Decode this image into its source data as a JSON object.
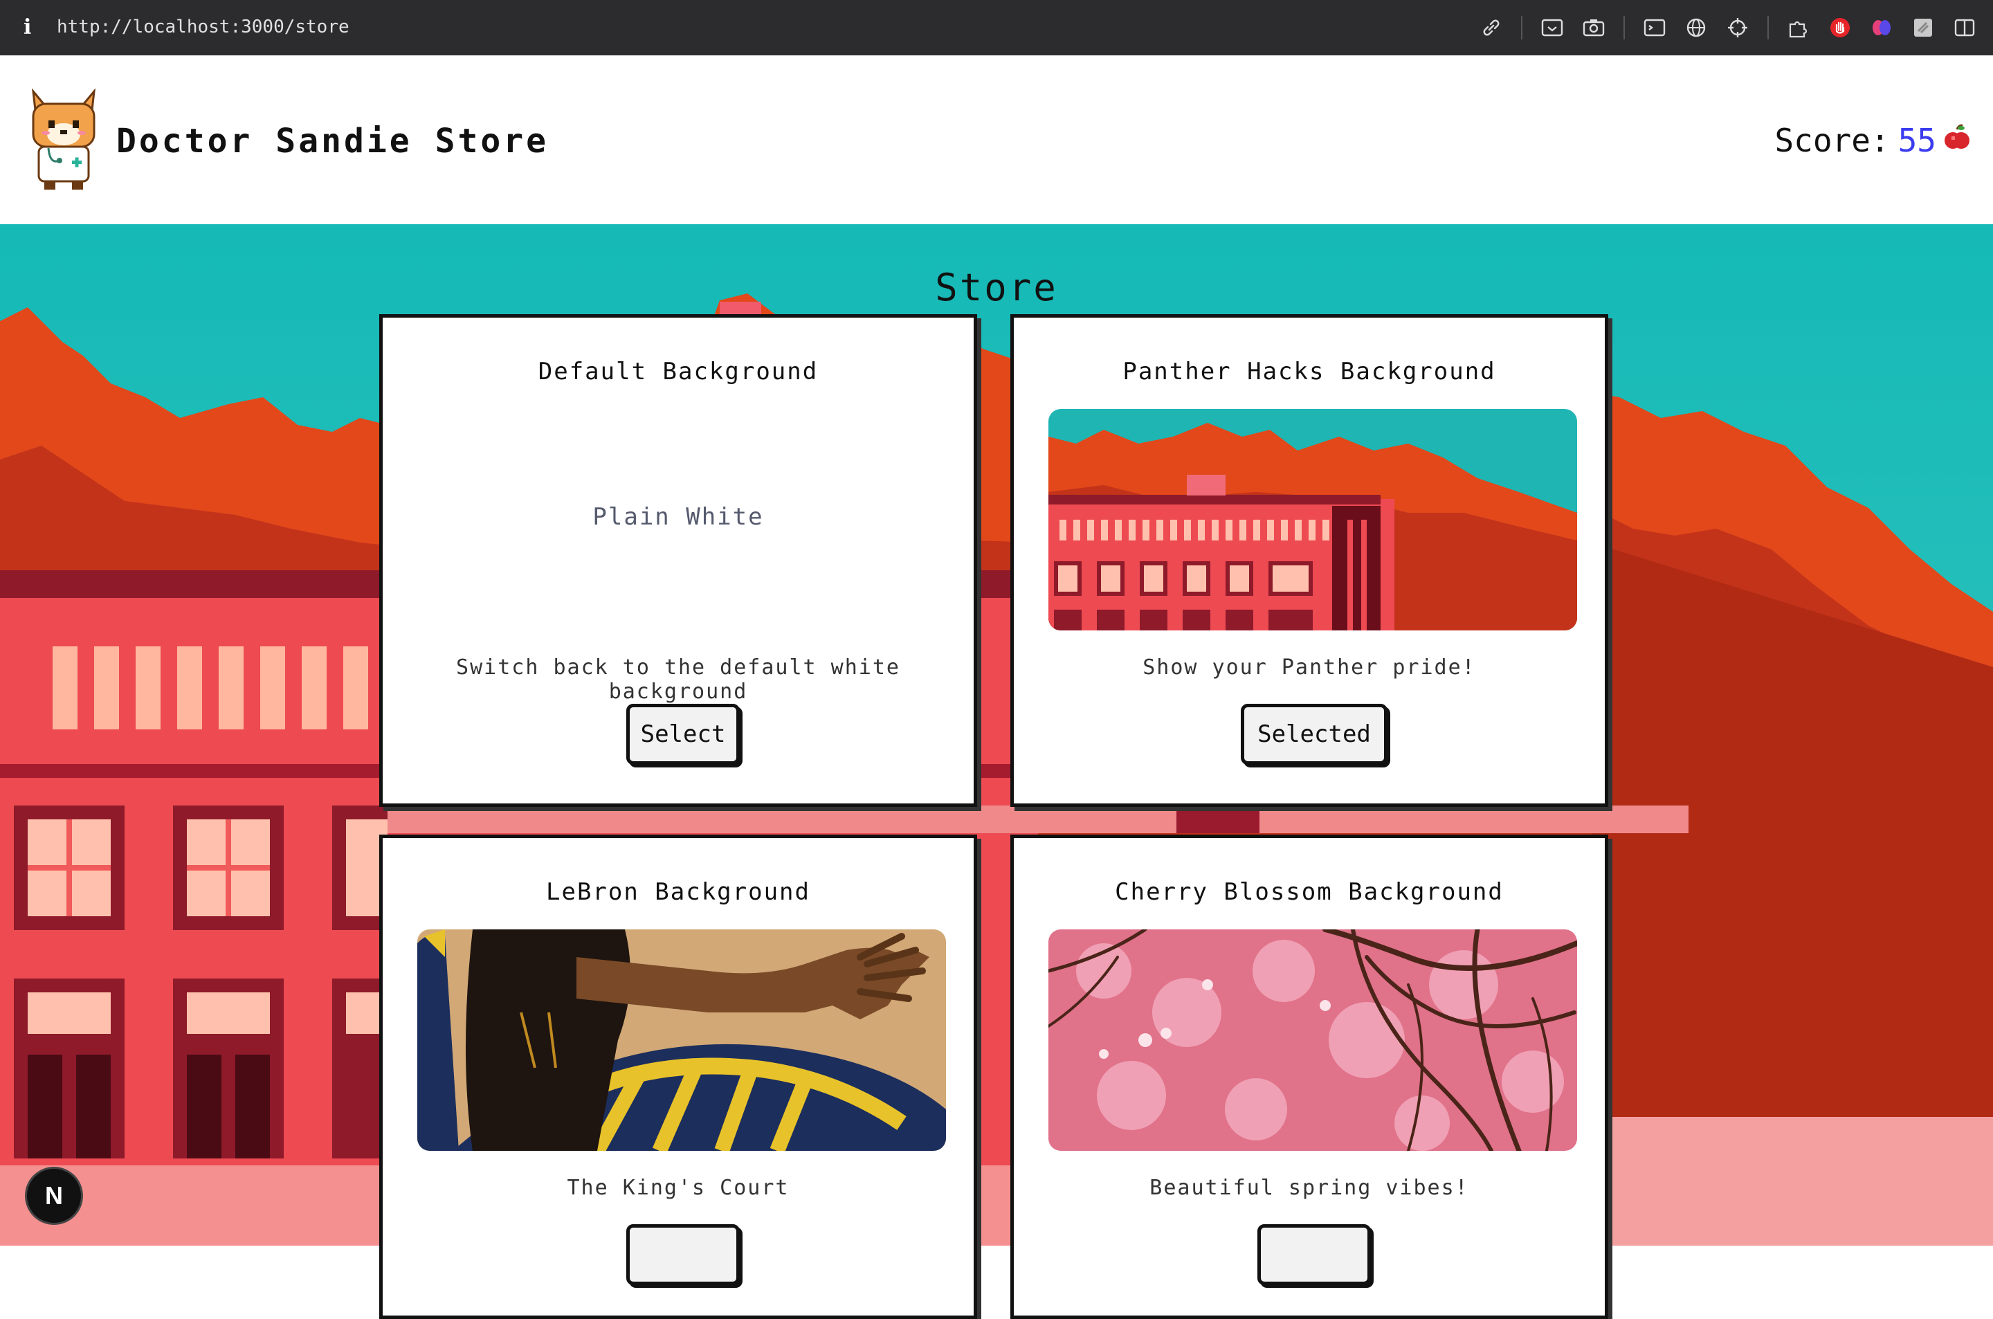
{
  "browser": {
    "url": "http://localhost:3000/store",
    "info_icon": "i",
    "icons": [
      "link-icon",
      "screenshot-icon",
      "camera-icon",
      "terminal-icon",
      "globe-icon",
      "crosshair-icon",
      "puzzle-icon",
      "hand-stop-icon",
      "brain-icon",
      "extension-icon",
      "sidebar-icon"
    ]
  },
  "header": {
    "brand": "Doctor Sandie Store",
    "score_label": "Score:",
    "score_value": "55",
    "score_icon": "apple-icon"
  },
  "page": {
    "title": "Store"
  },
  "cards": [
    {
      "title": "Default Background",
      "preview_text": "Plain White",
      "description": "Switch back to the default white background",
      "button": "Select"
    },
    {
      "title": "Panther Hacks Background",
      "description": "Show your Panther pride!",
      "button": "Selected"
    },
    {
      "title": "LeBron Background",
      "description": "The King's Court",
      "button": ""
    },
    {
      "title": "Cherry Blossom Background",
      "description": "Beautiful spring vibes!",
      "button": ""
    }
  ],
  "badge": {
    "label": "N"
  },
  "colors": {
    "sky": "#15b9b6",
    "mountain_orange": "#e04a1a",
    "mountain_red": "#b32a12",
    "building": "#ee4a52",
    "score_value": "#3b3bf0"
  }
}
